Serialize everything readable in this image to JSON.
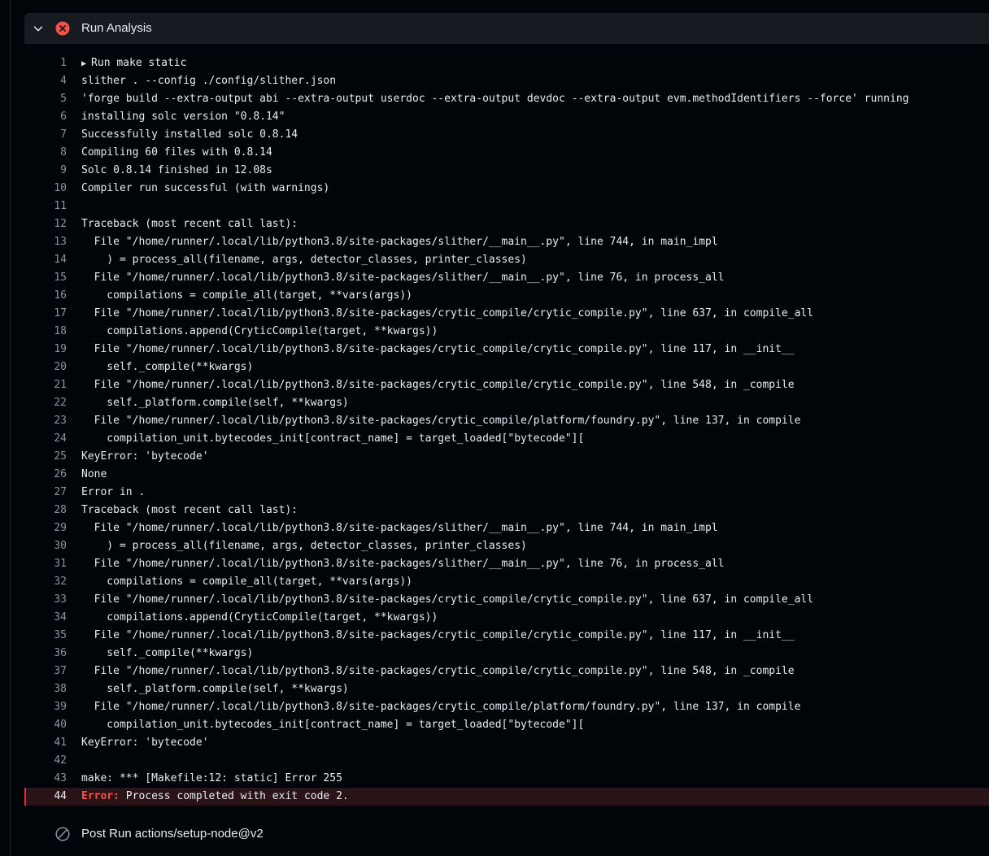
{
  "step": {
    "title": "Run Analysis",
    "status": "failed",
    "status_color": "#f85149",
    "expanded": true
  },
  "log_lines": [
    {
      "num": "1",
      "text": "Run make static",
      "collapsible": true
    },
    {
      "num": "4",
      "text": "slither . --config ./config/slither.json"
    },
    {
      "num": "5",
      "text": "'forge build --extra-output abi --extra-output userdoc --extra-output devdoc --extra-output evm.methodIdentifiers --force' running"
    },
    {
      "num": "6",
      "text": "installing solc version \"0.8.14\""
    },
    {
      "num": "7",
      "text": "Successfully installed solc 0.8.14"
    },
    {
      "num": "8",
      "text": "Compiling 60 files with 0.8.14"
    },
    {
      "num": "9",
      "text": "Solc 0.8.14 finished in 12.08s"
    },
    {
      "num": "10",
      "text": "Compiler run successful (with warnings)"
    },
    {
      "num": "11",
      "text": ""
    },
    {
      "num": "12",
      "text": "Traceback (most recent call last):"
    },
    {
      "num": "13",
      "text": "  File \"/home/runner/.local/lib/python3.8/site-packages/slither/__main__.py\", line 744, in main_impl"
    },
    {
      "num": "14",
      "text": "    ) = process_all(filename, args, detector_classes, printer_classes)"
    },
    {
      "num": "15",
      "text": "  File \"/home/runner/.local/lib/python3.8/site-packages/slither/__main__.py\", line 76, in process_all"
    },
    {
      "num": "16",
      "text": "    compilations = compile_all(target, **vars(args))"
    },
    {
      "num": "17",
      "text": "  File \"/home/runner/.local/lib/python3.8/site-packages/crytic_compile/crytic_compile.py\", line 637, in compile_all"
    },
    {
      "num": "18",
      "text": "    compilations.append(CryticCompile(target, **kwargs))"
    },
    {
      "num": "19",
      "text": "  File \"/home/runner/.local/lib/python3.8/site-packages/crytic_compile/crytic_compile.py\", line 117, in __init__"
    },
    {
      "num": "20",
      "text": "    self._compile(**kwargs)"
    },
    {
      "num": "21",
      "text": "  File \"/home/runner/.local/lib/python3.8/site-packages/crytic_compile/crytic_compile.py\", line 548, in _compile"
    },
    {
      "num": "22",
      "text": "    self._platform.compile(self, **kwargs)"
    },
    {
      "num": "23",
      "text": "  File \"/home/runner/.local/lib/python3.8/site-packages/crytic_compile/platform/foundry.py\", line 137, in compile"
    },
    {
      "num": "24",
      "text": "    compilation_unit.bytecodes_init[contract_name] = target_loaded[\"bytecode\"]["
    },
    {
      "num": "25",
      "text": "KeyError: 'bytecode'"
    },
    {
      "num": "26",
      "text": "None"
    },
    {
      "num": "27",
      "text": "Error in ."
    },
    {
      "num": "28",
      "text": "Traceback (most recent call last):"
    },
    {
      "num": "29",
      "text": "  File \"/home/runner/.local/lib/python3.8/site-packages/slither/__main__.py\", line 744, in main_impl"
    },
    {
      "num": "30",
      "text": "    ) = process_all(filename, args, detector_classes, printer_classes)"
    },
    {
      "num": "31",
      "text": "  File \"/home/runner/.local/lib/python3.8/site-packages/slither/__main__.py\", line 76, in process_all"
    },
    {
      "num": "32",
      "text": "    compilations = compile_all(target, **vars(args))"
    },
    {
      "num": "33",
      "text": "  File \"/home/runner/.local/lib/python3.8/site-packages/crytic_compile/crytic_compile.py\", line 637, in compile_all"
    },
    {
      "num": "34",
      "text": "    compilations.append(CryticCompile(target, **kwargs))"
    },
    {
      "num": "35",
      "text": "  File \"/home/runner/.local/lib/python3.8/site-packages/crytic_compile/crytic_compile.py\", line 117, in __init__"
    },
    {
      "num": "36",
      "text": "    self._compile(**kwargs)"
    },
    {
      "num": "37",
      "text": "  File \"/home/runner/.local/lib/python3.8/site-packages/crytic_compile/crytic_compile.py\", line 548, in _compile"
    },
    {
      "num": "38",
      "text": "    self._platform.compile(self, **kwargs)"
    },
    {
      "num": "39",
      "text": "  File \"/home/runner/.local/lib/python3.8/site-packages/crytic_compile/platform/foundry.py\", line 137, in compile"
    },
    {
      "num": "40",
      "text": "    compilation_unit.bytecodes_init[contract_name] = target_loaded[\"bytecode\"]["
    },
    {
      "num": "41",
      "text": "KeyError: 'bytecode'"
    },
    {
      "num": "42",
      "text": ""
    },
    {
      "num": "43",
      "text": "make: *** [Makefile:12: static] Error 255"
    },
    {
      "num": "44",
      "text": " Process completed with exit code 2.",
      "error_label": "Error:",
      "is_error": true
    }
  ],
  "post_step": {
    "title": "Post Run actions/setup-node@v2",
    "status": "skipped"
  },
  "colors": {
    "background": "#010409",
    "header_bg": "#161b22",
    "error_red": "#f85149",
    "error_row_bg": "#2b1418",
    "line_number": "#8b949e",
    "text": "#e6edf3"
  },
  "icons": {
    "chevron": "chevron-down-icon",
    "step_status": "x-circle-fill-icon",
    "post_status": "skip-circle-icon",
    "collapsible": "triangle-right-icon"
  }
}
